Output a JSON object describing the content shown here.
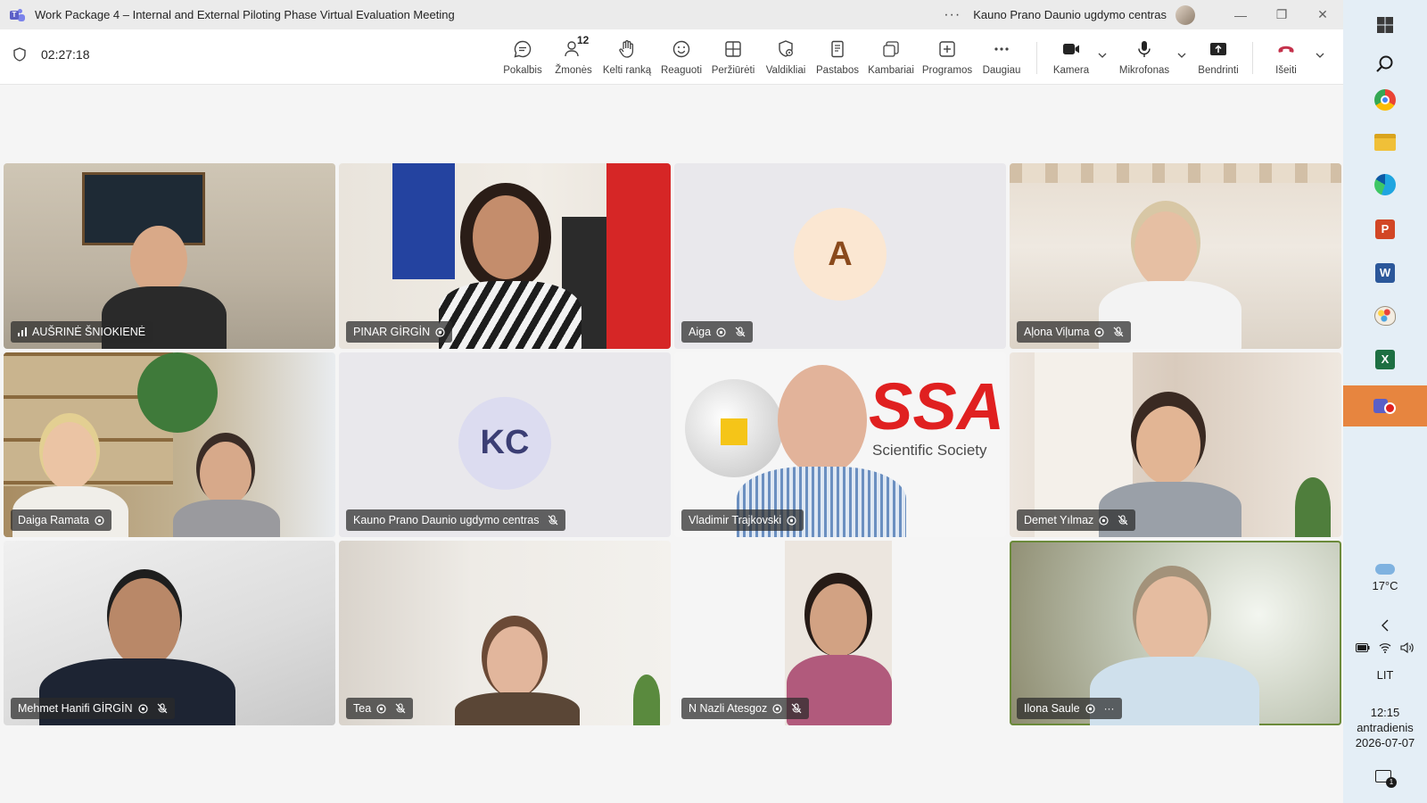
{
  "window": {
    "title": "Work Package 4 – Internal and External Piloting Phase Virtual Evaluation Meeting",
    "more": "···",
    "organization": "Kauno Prano Daunio ugdymo centras",
    "minimize": "—",
    "restore": "❐",
    "close": "✕"
  },
  "meeting": {
    "timer": "02:27:18"
  },
  "toolbar": {
    "chat": "Pokalbis",
    "people": "Žmonės",
    "people_count": "12",
    "raise_hand": "Kelti ranką",
    "react": "Reaguoti",
    "view": "Peržiūrėti",
    "controls": "Valdikliai",
    "notes": "Pastabos",
    "rooms": "Kambariai",
    "apps": "Programos",
    "more": "Daugiau",
    "camera": "Kamera",
    "microphone": "Mikrofonas",
    "share": "Bendrinti",
    "leave": "Išeiti"
  },
  "participants": [
    {
      "name": "AUŠRINĖ ŠNIOKIENĖ"
    },
    {
      "name": "PINAR GİRGİN"
    },
    {
      "name": "Aiga",
      "initials": "A"
    },
    {
      "name": "Aļona Viļuma"
    },
    {
      "name": "Daiga Ramata"
    },
    {
      "name": "Kauno Prano Daunio ugdymo centras",
      "initials": "KC"
    },
    {
      "name": "Vladimir Trajkovski",
      "backdrop_text": "SSA",
      "backdrop_subtext": "Scientific Society"
    },
    {
      "name": "Demet Yılmaz"
    },
    {
      "name": "Mehmet Hanifi GİRGİN"
    },
    {
      "name": "Tea"
    },
    {
      "name": "N Nazli Atesgoz"
    },
    {
      "name": "Ilona Saule",
      "more": "···"
    }
  ],
  "taskbar": {
    "weather": "17°C",
    "language": "LIT",
    "time": "12:15",
    "day": "antradienis",
    "date": "2026-07-07",
    "notifications": "1"
  },
  "colors": {
    "teams_purple": "#5b5fc7",
    "leave_red": "#c4314b",
    "taskbar_bg": "#e4eef6",
    "active_app": "#e7853f"
  }
}
